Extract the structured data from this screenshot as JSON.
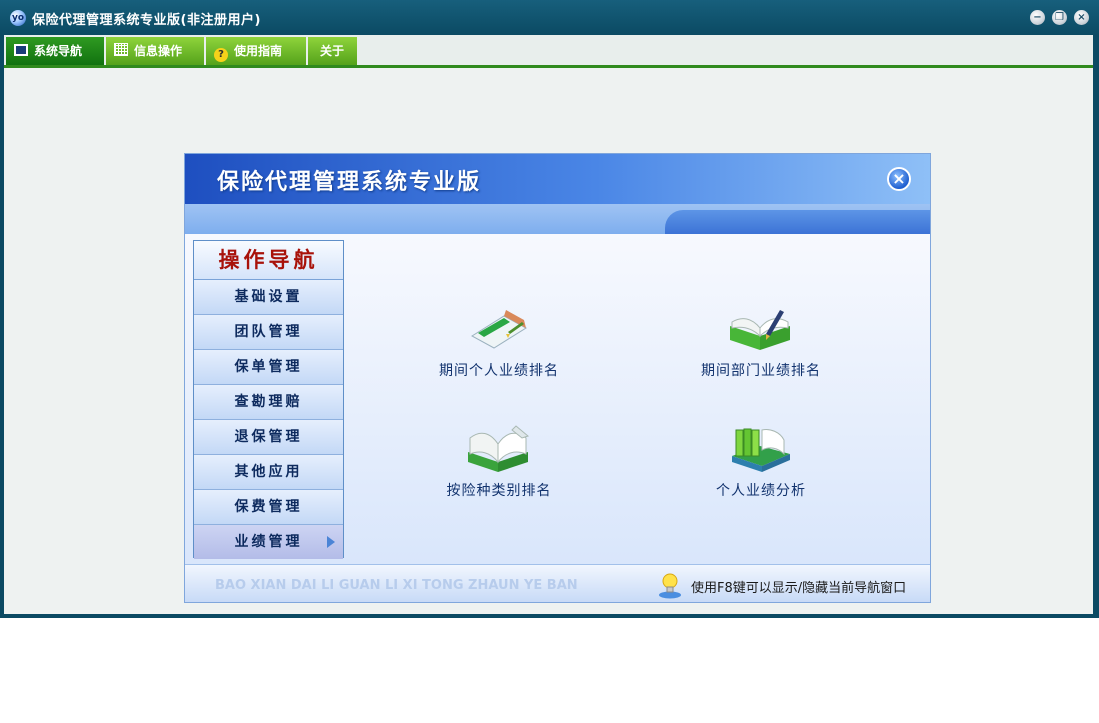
{
  "window": {
    "title": "保险代理管理系统专业版(非注册用户)"
  },
  "menu": [
    {
      "label": "系统导航",
      "icon": "monitor-icon"
    },
    {
      "label": "信息操作",
      "icon": "grid-icon"
    },
    {
      "label": "使用指南",
      "icon": "help-icon"
    },
    {
      "label": "关于"
    }
  ],
  "panel": {
    "title": "保险代理管理系统专业版",
    "nav_title": "操作导航",
    "nav_items": [
      "基础设置",
      "团队管理",
      "保单管理",
      "查勘理赔",
      "退保管理",
      "其他应用",
      "保费管理",
      "业绩管理"
    ],
    "features": [
      {
        "label": "期间个人业绩排名",
        "icon": "notebook-pen-icon"
      },
      {
        "label": "期间部门业绩排名",
        "icon": "open-book-pen-icon"
      },
      {
        "label": "按险种类别排名",
        "icon": "open-book-icon"
      },
      {
        "label": "个人业绩分析",
        "icon": "book-stack-icon"
      }
    ],
    "footer_pinyin": "BAO XIAN DAI LI GUAN LI XI TONG ZHAUN YE BAN",
    "footer_tip": "使用F8键可以显示/隐藏当前导航窗口"
  },
  "colors": {
    "title_bar": "#0b4a63",
    "menu_active": "#117210",
    "menu_item": "#54a21b",
    "nav_title": "#a8120a"
  }
}
